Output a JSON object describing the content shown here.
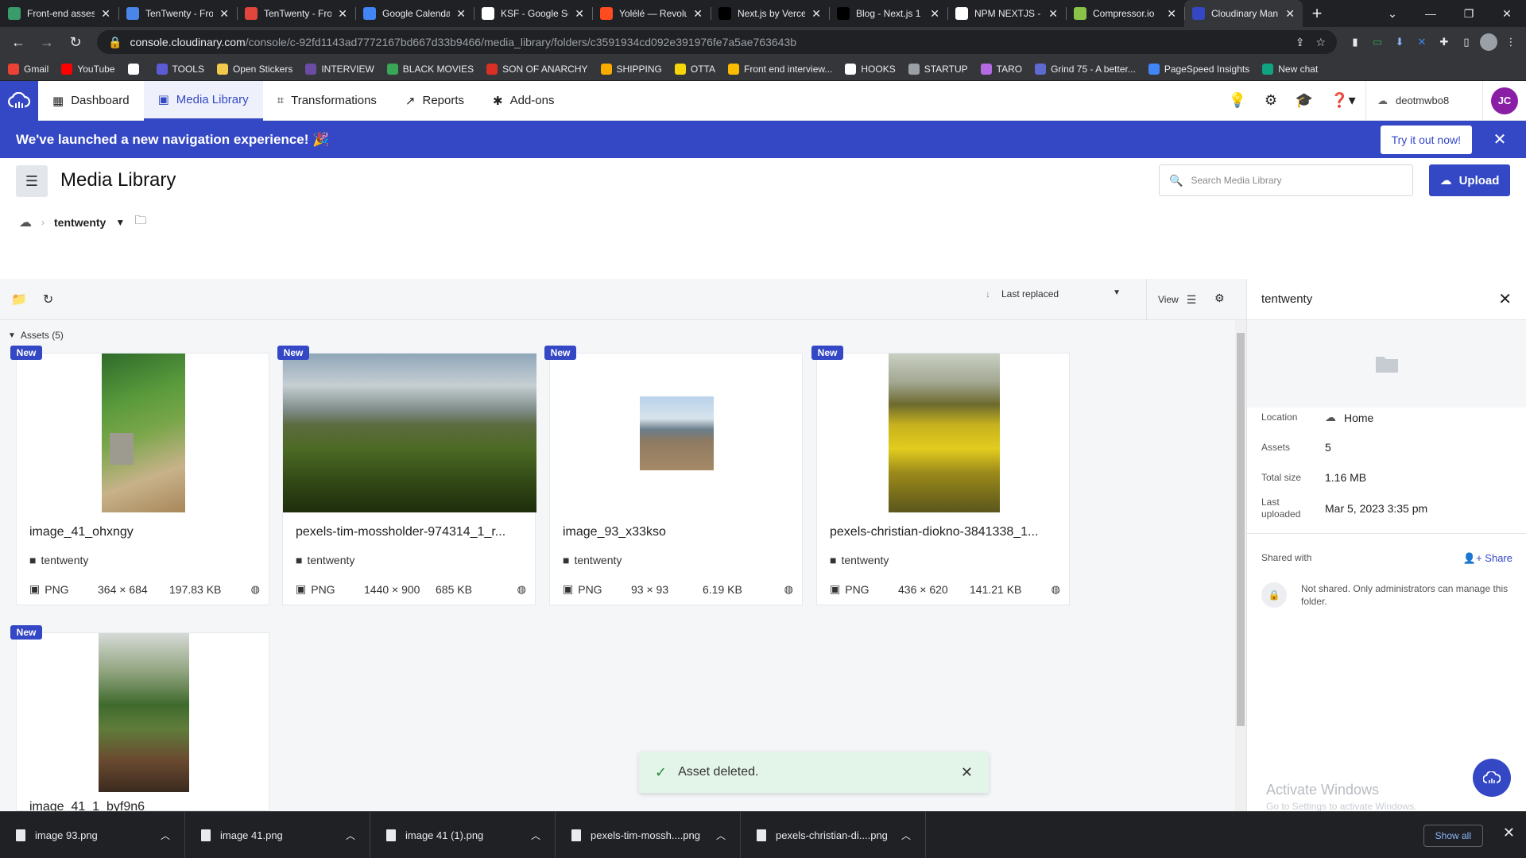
{
  "browser": {
    "tabs": [
      {
        "label": "Front-end asses",
        "color": "#3a9b6b"
      },
      {
        "label": "TenTwenty - Fro",
        "color": "#4a86e8"
      },
      {
        "label": "TenTwenty - Fro",
        "color": "#e0463b"
      },
      {
        "label": "Google Calenda",
        "color": "#4285f4"
      },
      {
        "label": "KSF - Google Se",
        "color": "#ffffff"
      },
      {
        "label": "Yolélé — Revolu",
        "color": "#ff4b1f"
      },
      {
        "label": "Next.js by Verce",
        "color": "#000000"
      },
      {
        "label": "Blog - Next.js 1",
        "color": "#000000"
      },
      {
        "label": "NPM NEXTJS - (",
        "color": "#ffffff"
      },
      {
        "label": "Compressor.io",
        "color": "#8bc34a"
      },
      {
        "label": "Cloudinary Man",
        "color": "#3448c5"
      }
    ],
    "url_host": "console.cloudinary.com",
    "url_path": "/console/c-92fd1143ad7772167bd667d33b9466/media_library/folders/c3591934cd092e391976fe7a5ae763643b",
    "bookmarks": [
      {
        "label": "Gmail",
        "color": "#ea4335"
      },
      {
        "label": "YouTube",
        "color": "#ff0000"
      },
      {
        "label": "",
        "color": "#ffffff"
      },
      {
        "label": "TOOLS",
        "color": "#5b5bd6"
      },
      {
        "label": "Open Stickers",
        "color": "#f2c94c"
      },
      {
        "label": "INTERVIEW",
        "color": "#6b4ca5"
      },
      {
        "label": "BLACK MOVIES",
        "color": "#3aa757"
      },
      {
        "label": "SON OF ANARCHY",
        "color": "#d93025"
      },
      {
        "label": "SHIPPING",
        "color": "#f9ab00"
      },
      {
        "label": "OTTA",
        "color": "#f6d50a"
      },
      {
        "label": "Front end interview...",
        "color": "#fbbc04"
      },
      {
        "label": "HOOKS",
        "color": "#ffffff"
      },
      {
        "label": "STARTUP",
        "color": "#9aa0a6"
      },
      {
        "label": "TARO",
        "color": "#b36ae2"
      },
      {
        "label": "Grind 75 - A better...",
        "color": "#5e6ad2"
      },
      {
        "label": "PageSpeed Insights",
        "color": "#4285f4"
      },
      {
        "label": "New chat",
        "color": "#10a37f"
      }
    ]
  },
  "nav": {
    "items": [
      {
        "label": "Dashboard",
        "icon": "▦"
      },
      {
        "label": "Media Library",
        "icon": "▣"
      },
      {
        "label": "Transformations",
        "icon": "⌗"
      },
      {
        "label": "Reports",
        "icon": "↗"
      },
      {
        "label": "Add-ons",
        "icon": "✱"
      }
    ],
    "cloud_name": "deotmwbo8",
    "avatar_initials": "JC"
  },
  "banner": {
    "text": "We've launched a new navigation experience! 🎉",
    "button": "Try it out now!"
  },
  "page": {
    "title": "Media Library",
    "search_placeholder": "Search Media Library",
    "upload_label": "Upload",
    "breadcrumb_folder": "tentwenty"
  },
  "toolbar": {
    "sort_label": "Last replaced",
    "view_label": "View"
  },
  "assets": {
    "header": "Assets (5)",
    "badge": "New",
    "items": [
      {
        "name": "image_41_ohxngy",
        "folder": "tentwenty",
        "format": "PNG",
        "dims": "364 × 684",
        "size": "197.83 KB"
      },
      {
        "name": "pexels-tim-mossholder-974314_1_r...",
        "folder": "tentwenty",
        "format": "PNG",
        "dims": "1440 × 900",
        "size": "685 KB"
      },
      {
        "name": "image_93_x33kso",
        "folder": "tentwenty",
        "format": "PNG",
        "dims": "93 × 93",
        "size": "6.19 KB"
      },
      {
        "name": "pexels-christian-diokno-3841338_1...",
        "folder": "tentwenty",
        "format": "PNG",
        "dims": "436 × 620",
        "size": "141.21 KB"
      },
      {
        "name": "image_41_1_byf9n6",
        "folder": "",
        "format": "",
        "dims": "",
        "size": ""
      }
    ]
  },
  "details": {
    "title": "tentwenty",
    "location_label": "Location",
    "location_value": "Home",
    "assets_label": "Assets",
    "assets_value": "5",
    "total_size_label": "Total size",
    "total_size_value": "1.16 MB",
    "last_uploaded_label": "Last uploaded",
    "last_uploaded_value": "Mar 5, 2023 3:35 pm",
    "shared_with_label": "Shared with",
    "share_label": "Share",
    "not_shared_text": "Not shared. Only administrators can manage this folder.",
    "watermark_title": "Activate Windows",
    "watermark_sub": "Go to Settings to activate Windows."
  },
  "toast": {
    "message": "Asset deleted."
  },
  "downloads": {
    "files": [
      "image 93.png",
      "image 41.png",
      "image 41 (1).png",
      "pexels-tim-mossh....png",
      "pexels-christian-di....png"
    ],
    "show_all": "Show all"
  }
}
